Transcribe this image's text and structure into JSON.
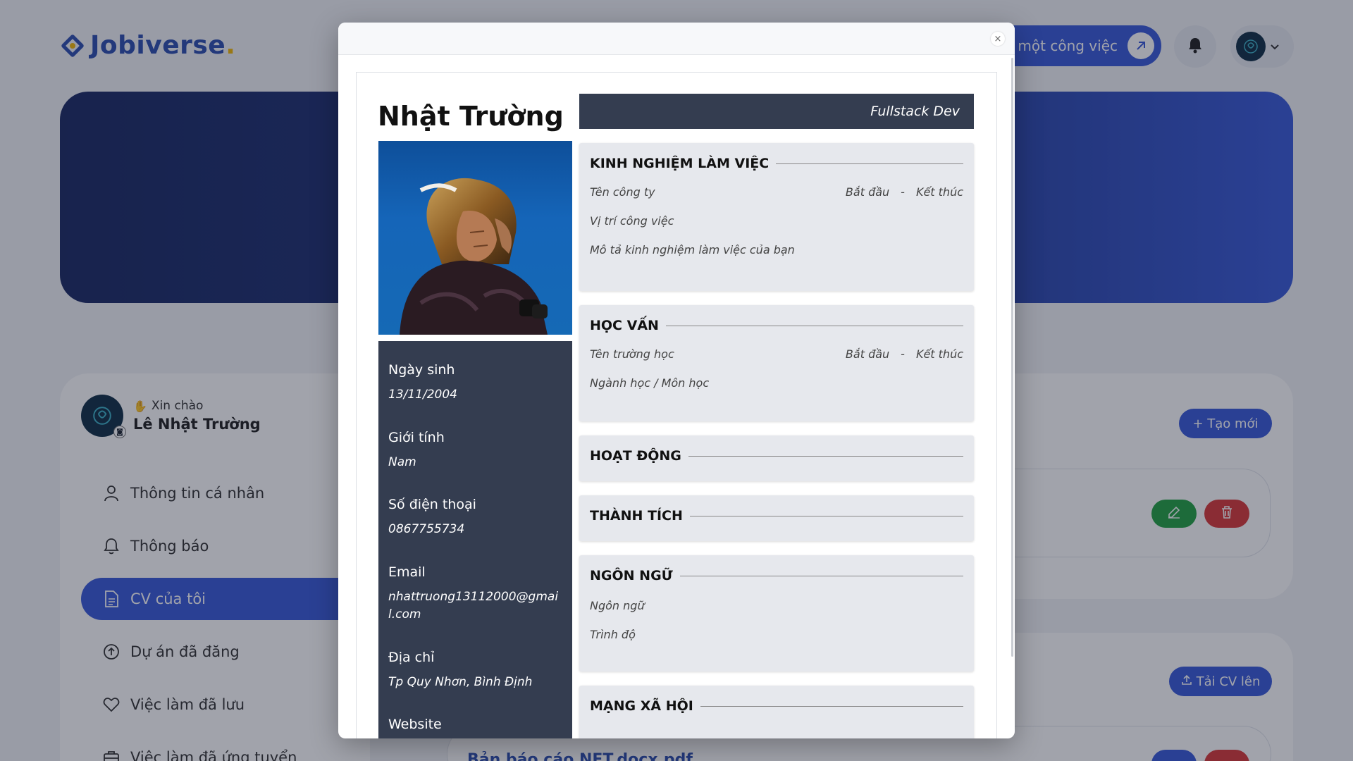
{
  "header": {
    "logo_text": "Jobiverse",
    "logo_dot": ".",
    "post_job_label": "g một công việc"
  },
  "sidebar": {
    "greeting": "Xin chào",
    "user_name": "Lê Nhật Trường",
    "items": [
      {
        "label": "Thông tin cá nhân",
        "icon": "user-icon"
      },
      {
        "label": "Thông báo",
        "icon": "bell-icon"
      },
      {
        "label": "CV của tôi",
        "icon": "document-icon",
        "active": true
      },
      {
        "label": "Dự án đã đăng",
        "icon": "upload-circle-icon"
      },
      {
        "label": "Việc làm đã lưu",
        "icon": "heart-icon"
      },
      {
        "label": "Việc làm đã ứng tuyển",
        "icon": "briefcase-icon"
      }
    ]
  },
  "main": {
    "create_label": "+ Tạo mới",
    "upload_label": "Tải CV lên",
    "report_title": "Bản báo cáo NET.docx.pdf"
  },
  "cv": {
    "name": "Nhật Trường",
    "job_title": "Fullstack Dev",
    "info": [
      {
        "label": "Ngày sinh",
        "value": "13/11/2004"
      },
      {
        "label": "Giới tính",
        "value": "Nam"
      },
      {
        "label": "Số điện thoại",
        "value": "0867755734"
      },
      {
        "label": "Email",
        "value": "nhattruong13112000@gmail.com"
      },
      {
        "label": "Địa chỉ",
        "value": "Tp Quy Nhơn, Bình Định"
      },
      {
        "label": "Website",
        "value": ""
      }
    ],
    "experience": {
      "title": "KINH NGHIỆM LÀM VIỆC",
      "company": "Tên công ty",
      "start": "Bắt đầu",
      "dash": "-",
      "end": "Kết thúc",
      "position": "Vị trí công việc",
      "description": "Mô tả kinh nghiệm làm việc của bạn"
    },
    "education": {
      "title": "HỌC VẤN",
      "school": "Tên trường học",
      "start": "Bắt đầu",
      "dash": "-",
      "end": "Kết thúc",
      "major": "Ngành học / Môn học"
    },
    "activities": {
      "title": "HOẠT ĐỘNG"
    },
    "achievements": {
      "title": "THÀNH TÍCH"
    },
    "languages": {
      "title": "NGÔN NGỮ",
      "language": "Ngôn ngữ",
      "level": "Trình độ"
    },
    "social": {
      "title": "MẠNG XÃ HỘI"
    }
  },
  "modal": {
    "close_glyph": "×"
  },
  "colors": {
    "primary": "#3a5bd9",
    "dark_panel": "#343d50",
    "success": "#24a244",
    "danger": "#d93a3a"
  }
}
